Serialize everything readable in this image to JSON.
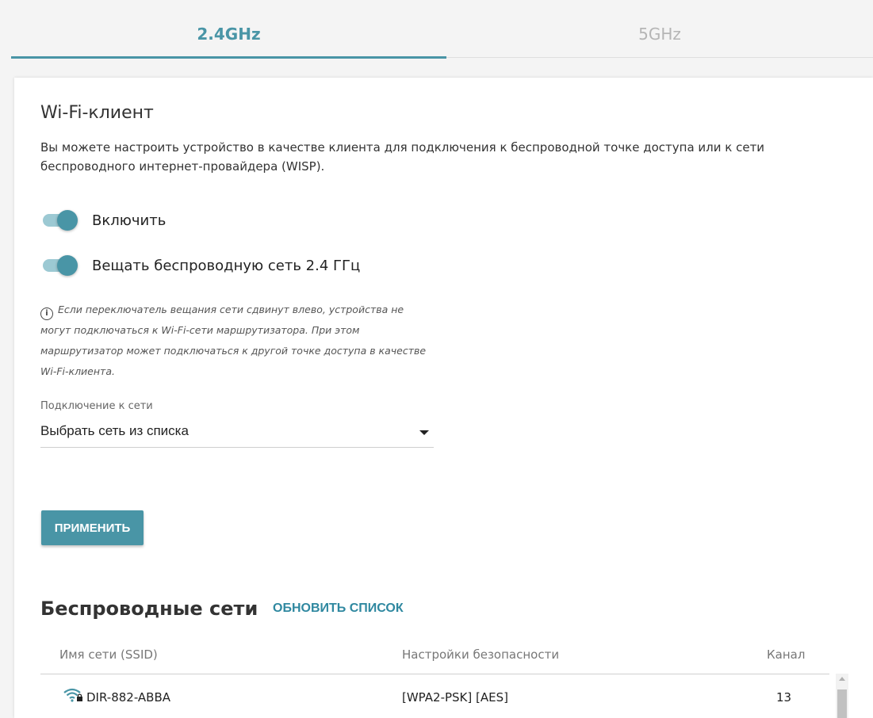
{
  "tabs": [
    {
      "label": "2.4GHz",
      "active": true
    },
    {
      "label": "5GHz",
      "active": false
    }
  ],
  "card": {
    "title": "Wi-Fi-клиент",
    "description": "Вы можете настроить устройство в качестве клиента для подключения к беспроводной точке доступа или к сети беспроводного интернет-провайдера (WISP).",
    "toggles": [
      {
        "label": "Включить",
        "on": true
      },
      {
        "label": "Вещать беспроводную сеть 2.4 ГГц",
        "on": true
      }
    ],
    "note": "Если переключатель вещания сети сдвинут влево, устройства не могут подключаться к Wi-Fi-сети маршрутизатора. При этом маршрутизатор может подключаться к другой точке доступа в качестве Wi-Fi-клиента.",
    "connection": {
      "label": "Подключение к сети",
      "value": "Выбрать сеть из списка"
    },
    "apply_label": "ПРИМЕНИТЬ"
  },
  "networks": {
    "title": "Беспроводные сети",
    "refresh_label": "ОБНОВИТЬ СПИСОК",
    "columns": [
      "Имя сети (SSID)",
      "Настройки безопасности",
      "Канал"
    ],
    "rows": [
      {
        "ssid": "DIR-882-ABBA",
        "security": "[WPA2-PSK] [AES]",
        "channel": "13"
      }
    ]
  },
  "colors": {
    "accent": "#4995a6",
    "link": "#2f88a0"
  }
}
